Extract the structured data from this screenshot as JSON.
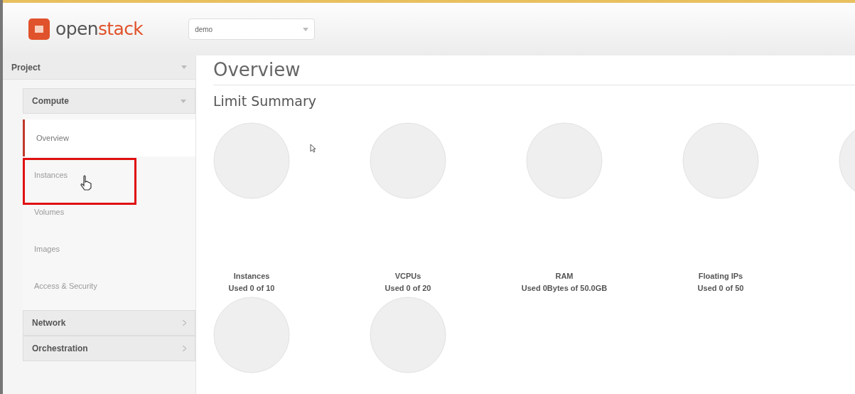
{
  "header": {
    "logo": {
      "text_dark": "open",
      "text_accent": "stack"
    },
    "project_select": {
      "value": "demo"
    }
  },
  "sidebar": {
    "dashboard": {
      "label": "Project",
      "expanded": true
    },
    "groups": [
      {
        "label": "Compute",
        "expanded": true,
        "items": [
          {
            "label": "Overview",
            "selected": true
          },
          {
            "label": "Instances",
            "selected": false,
            "highlighted": true
          },
          {
            "label": "Volumes",
            "selected": false,
            "highlighted": false
          },
          {
            "label": "Images",
            "selected": false,
            "highlighted": false
          },
          {
            "label": "Access & Security",
            "selected": false,
            "highlighted": false
          }
        ]
      },
      {
        "label": "Network",
        "expanded": false
      },
      {
        "label": "Orchestration",
        "expanded": false
      }
    ]
  },
  "main": {
    "title": "Overview",
    "section_title": "Limit Summary",
    "limits": [
      {
        "kind": "labelled",
        "name": "Instances",
        "usage": "Used 0 of 10"
      },
      {
        "kind": "labelled",
        "name": "VCPUs",
        "usage": "Used 0 of 20"
      },
      {
        "kind": "labelled",
        "name": "RAM",
        "usage": "Used 0Bytes of 50.0GB"
      },
      {
        "kind": "labelled",
        "name": "Floating IPs",
        "usage": "Used 0 of 50"
      },
      {
        "kind": "unlabelled"
      },
      {
        "kind": "unlabelled"
      },
      {
        "kind": "unlabelled"
      }
    ]
  }
}
